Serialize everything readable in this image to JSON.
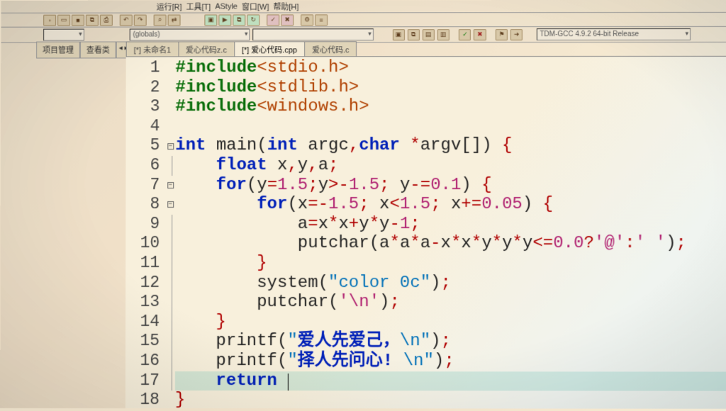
{
  "menubar": {
    "items": [
      "运行[R]",
      "工具[T]",
      "AStyle",
      "窗口[W]",
      "帮助[H]"
    ]
  },
  "toolbar2": {
    "globals": "(globals)",
    "compiler": "TDM-GCC 4.9.2 64-bit Release"
  },
  "leftTabs": {
    "project": "项目管理",
    "classes": "查看类",
    "more": "◂ ▸"
  },
  "tabs": [
    {
      "label": "[*] 未命名1",
      "active": false
    },
    {
      "label": "爱心代码z.c",
      "active": false
    },
    {
      "label": "[*] 爱心代码.cpp",
      "active": true
    },
    {
      "label": "爱心代码.c",
      "active": false
    }
  ],
  "code": {
    "lines": [
      {
        "n": 1,
        "fold": "",
        "t": "#include<stdio.h>"
      },
      {
        "n": 2,
        "fold": "",
        "t": "#include<stdlib.h>"
      },
      {
        "n": 3,
        "fold": "",
        "t": "#include<windows.h>"
      },
      {
        "n": 4,
        "fold": "",
        "t": ""
      },
      {
        "n": 5,
        "fold": "⊟",
        "t": "int main(int argc,char *argv[]) {"
      },
      {
        "n": 6,
        "fold": "|",
        "t": "    float x,y,a;"
      },
      {
        "n": 7,
        "fold": "⊟",
        "t": "    for(y=1.5;y>-1.5; y-=0.1) {"
      },
      {
        "n": 8,
        "fold": "⊟",
        "t": "        for(x=-1.5; x<1.5; x+=0.05) {"
      },
      {
        "n": 9,
        "fold": "|",
        "t": "            a=x*x+y*y-1;"
      },
      {
        "n": 10,
        "fold": "|",
        "t": "            putchar(a*a*a-x*x*y*y*y<=0.0?'@':' ');"
      },
      {
        "n": 11,
        "fold": "|",
        "t": "        }"
      },
      {
        "n": 12,
        "fold": "|",
        "t": "        system(\"color 0c\");"
      },
      {
        "n": 13,
        "fold": "|",
        "t": "        putchar('\\n');"
      },
      {
        "n": 14,
        "fold": "|",
        "t": "    }"
      },
      {
        "n": 15,
        "fold": "|",
        "t": "    printf(\"爱人先爱己，\\n\");"
      },
      {
        "n": 16,
        "fold": "|",
        "t": "    printf(\"择人先问心! \\n\");"
      },
      {
        "n": 17,
        "fold": "|",
        "t": "    return "
      },
      {
        "n": 18,
        "fold": "",
        "t": "}"
      }
    ]
  }
}
